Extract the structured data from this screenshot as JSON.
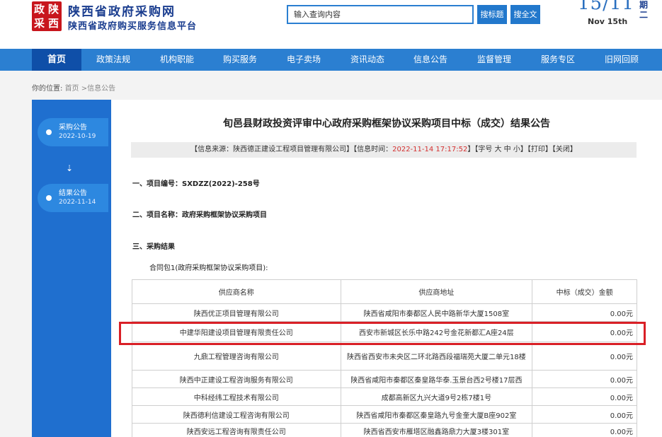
{
  "header": {
    "logo_chars": [
      "政",
      "陕",
      "采",
      "西"
    ],
    "site_title": "陕西省政府采购网",
    "site_subtitle": "陕西省政府购买服务信息平台",
    "search_placeholder": "输入查询内容",
    "search_title_button": "搜标题",
    "search_full_button": "搜全文",
    "date_big": "15/11",
    "date_week": "期二",
    "date_text": "Nov 15th"
  },
  "nav": {
    "items": [
      "首页",
      "政策法规",
      "机构职能",
      "购买服务",
      "电子卖场",
      "资讯动态",
      "信息公告",
      "监督管理",
      "服务专区",
      "旧网回顾"
    ],
    "active_index": 0
  },
  "breadcrumb": {
    "label": "你的位置:",
    "path": "首页 >信息公告"
  },
  "sidebar": {
    "items": [
      {
        "label": "采购公告",
        "date": "2022-10-19"
      },
      {
        "label": "结果公告",
        "date": "2022-11-14"
      }
    ],
    "arrow": "⇣"
  },
  "article": {
    "title": "旬邑县财政投资评审中心政府采购框架协议采购项目中标（成交）结果公告",
    "info": {
      "source_prefix": "【信息来源：陕西德正建设工程项目管理有限公司】【信息时间：",
      "time": "2022-11-14 17:17:52",
      "suffix": "】【字号 大 中 小】【打印】【关闭】"
    },
    "project_no": "一、项目编号：SXDZZ(2022)-258号",
    "project_name": "二、项目名称：政府采购框架协议采购项目",
    "section3": "三、采购结果",
    "package": "合同包1(政府采购框架协议采购项目):"
  },
  "table": {
    "headers": [
      "供应商名称",
      "供应商地址",
      "中标（成交）金额"
    ],
    "rows": [
      [
        "陕西优正项目管理有限公司",
        "陕西省咸阳市秦都区人民中路新华大厦1508室",
        "0.00元"
      ],
      [
        "中建华阳建设项目管理有限责任公司",
        "西安市新城区长乐中路242号金花新都汇A座24层",
        "0.00元"
      ],
      [
        "九鼎工程管理咨询有限公司",
        "陕西省西安市未央区二环北路西段福瑞苑大厦二单元18楼",
        "0.00元"
      ],
      [
        "陕西中正建设工程咨询服务有限公司",
        "陕西省咸阳市秦都区秦皇路华泰.玉景台西2号楼17层西",
        "0.00元"
      ],
      [
        "中科经纬工程技术有限公司",
        "成都高新区九兴大道9号2栋7楼1号",
        "0.00元"
      ],
      [
        "陕西德利信建设工程咨询有限公司",
        "陕西省咸阳市秦都区秦皇路九号金奎大厦B座902室",
        "0.00元"
      ],
      [
        "陕西安远工程咨询有限责任公司",
        "陕西省西安市雁塔区融鑫路鼎力大厦3楼301室",
        "0.00元"
      ]
    ]
  },
  "colors": {
    "nav_blue": "#2b7fd1",
    "nav_active": "#0f4fa8",
    "sidebar_blue": "#1f6fcf",
    "highlight_red": "#d91f26",
    "logo_red": "#c8161d"
  }
}
